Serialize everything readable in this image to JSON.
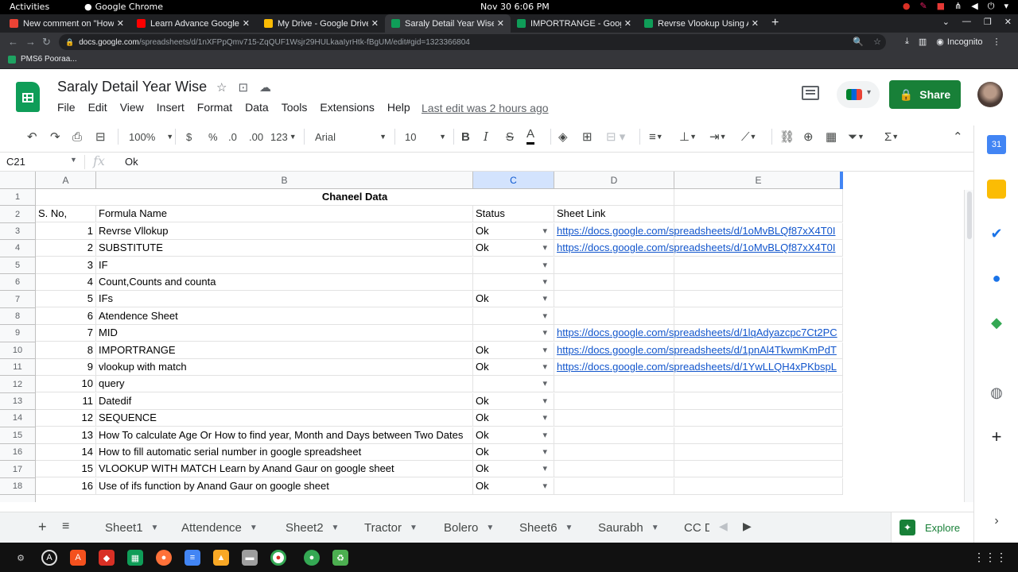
{
  "system_bar": {
    "activities": "Activities",
    "app_name": "Google Chrome",
    "clock": "Nov 30  6:06 PM"
  },
  "browser": {
    "tabs": [
      {
        "label": "New comment on \"How t",
        "favicon_color": "#ea4335"
      },
      {
        "label": "Learn Advance Google Sh",
        "favicon_color": "#ff0000"
      },
      {
        "label": "My Drive - Google Drive",
        "favicon_color": "#fbbc04"
      },
      {
        "label": "Saraly Detail Year Wise - G",
        "favicon_color": "#0f9d58",
        "active": true
      },
      {
        "label": "IMPORTRANGE - Google S",
        "favicon_color": "#0f9d58"
      },
      {
        "label": "Revrse Vlookup Using Ar",
        "favicon_color": "#0f9d58"
      }
    ],
    "url_host": "docs.google.com",
    "url_path": "/spreadsheets/d/1nXFPpQmv715-ZqQUF1Wsjr29HULkaaIyrHtk-fBgUM/edit#gid=1323366804",
    "incognito_label": "Incognito",
    "bookmark": "PMS6 Pooraa..."
  },
  "doc": {
    "title": "Saraly Detail Year Wise",
    "menus": [
      "File",
      "Edit",
      "View",
      "Insert",
      "Format",
      "Data",
      "Tools",
      "Extensions",
      "Help"
    ],
    "last_edit": "Last edit was 2 hours ago",
    "share_label": "Share"
  },
  "toolbar": {
    "zoom": "100%",
    "currency": "$",
    "percent": "%",
    "dec_decrease": ".0",
    "dec_increase": ".00",
    "number_format": "123",
    "font": "Arial",
    "font_size": "10"
  },
  "formula_bar": {
    "cell_ref": "C21",
    "fx": "fx",
    "value": "Ok"
  },
  "grid": {
    "columns": [
      "A",
      "B",
      "C",
      "D",
      "E"
    ],
    "title_row": "Chaneel Data",
    "headers": [
      "S. No,",
      "Formula Name",
      "Status",
      "Sheet Link",
      ""
    ],
    "rows": [
      {
        "n": "3",
        "sno": "1",
        "name": "Revrse Vllokup",
        "status": "Ok",
        "link": "https://docs.google.com/spreadsheets/d/1oMvBLQf87xX4T0I"
      },
      {
        "n": "4",
        "sno": "2",
        "name": "SUBSTITUTE",
        "status": "Ok",
        "link": "https://docs.google.com/spreadsheets/d/1oMvBLQf87xX4T0I"
      },
      {
        "n": "5",
        "sno": "3",
        "name": "IF",
        "status": "",
        "link": ""
      },
      {
        "n": "6",
        "sno": "4",
        "name": "Count,Counts and counta",
        "status": "",
        "link": ""
      },
      {
        "n": "7",
        "sno": "5",
        "name": "IFs",
        "status": "Ok",
        "link": ""
      },
      {
        "n": "8",
        "sno": "6",
        "name": "Atendence Sheet",
        "status": "",
        "link": ""
      },
      {
        "n": "9",
        "sno": "7",
        "name": "MID",
        "status": "",
        "link": "https://docs.google.com/spreadsheets/d/1lqAdyazcpc7Ct2PC"
      },
      {
        "n": "10",
        "sno": "8",
        "name": "IMPORTRANGE",
        "status": "Ok",
        "link": "https://docs.google.com/spreadsheets/d/1pnAl4TkwmKmPdT"
      },
      {
        "n": "11",
        "sno": "9",
        "name": "vlookup with match",
        "status": "Ok",
        "link": "https://docs.google.com/spreadsheets/d/1YwLLQH4xPKbspL"
      },
      {
        "n": "12",
        "sno": "10",
        "name": "query",
        "status": "",
        "link": ""
      },
      {
        "n": "13",
        "sno": "11",
        "name": "Datedif",
        "status": "Ok",
        "link": ""
      },
      {
        "n": "14",
        "sno": "12",
        "name": "SEQUENCE",
        "status": "Ok",
        "link": ""
      },
      {
        "n": "15",
        "sno": "13",
        "name": "How To calculate Age Or How to find year, Month and Days between Two Dates",
        "status": "Ok",
        "link": ""
      },
      {
        "n": "16",
        "sno": "14",
        "name": "How to fill automatic serial number in google spreadsheet",
        "status": "Ok",
        "link": ""
      },
      {
        "n": "17",
        "sno": "15",
        "name": "VLOOKUP WITH MATCH Learn by Anand Gaur on google sheet",
        "status": "Ok",
        "link": ""
      },
      {
        "n": "18",
        "sno": "16",
        "name": "Use of ifs function by Anand Gaur on google sheet",
        "status": "Ok",
        "link": ""
      }
    ]
  },
  "sheet_tabs": [
    "Sheet1",
    "Attendence",
    "Sheet2",
    "Tractor",
    "Bolero",
    "Sheet6",
    "Saurabh",
    "CC D"
  ],
  "explore_label": "Explore"
}
